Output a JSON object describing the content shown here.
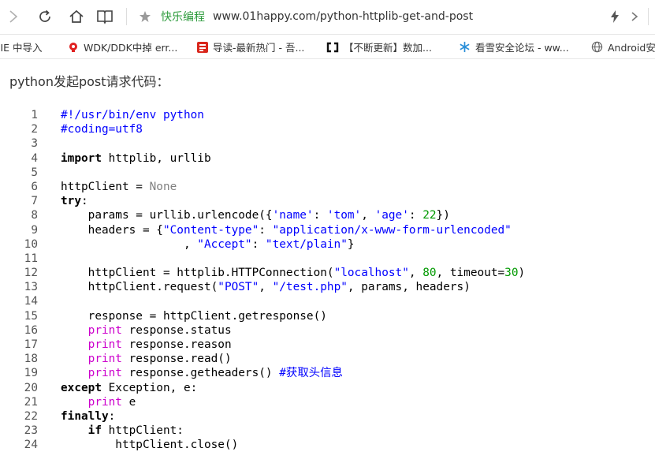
{
  "browser": {
    "site_name": "快乐编程",
    "url": "www.01happy.com/python-httplib-get-and-post",
    "bookmarks": [
      {
        "label": "入IE 中导入",
        "icon": "import-icon"
      },
      {
        "label": "WDK/DDK中掉 err...",
        "icon": "red-favicon"
      },
      {
        "label": "导读-最新热门 - 吾...",
        "icon": "red-square-favicon"
      },
      {
        "label": "【不断更新】数加...",
        "icon": "bracket-favicon"
      },
      {
        "label": "看雪安全论坛 - ww...",
        "icon": "snowflake-icon"
      },
      {
        "label": "Android安",
        "icon": "globe-icon"
      }
    ]
  },
  "article": {
    "intro": "python发起post请求代码："
  },
  "code": [
    {
      "n": "1",
      "t": [
        [
          "cm",
          "#!/usr/bin/env python"
        ]
      ]
    },
    {
      "n": "2",
      "t": [
        [
          "cm",
          "#coding=utf8"
        ]
      ]
    },
    {
      "n": "3",
      "t": []
    },
    {
      "n": "4",
      "t": [
        [
          "kw",
          "import"
        ],
        [
          "",
          " httplib, urllib"
        ]
      ]
    },
    {
      "n": "5",
      "t": []
    },
    {
      "n": "6",
      "t": [
        [
          "",
          "httpClient = "
        ],
        [
          "cs",
          "None"
        ]
      ]
    },
    {
      "n": "7",
      "t": [
        [
          "kw",
          "try"
        ],
        [
          "",
          ":"
        ]
      ]
    },
    {
      "n": "8",
      "t": [
        [
          "",
          "    params = urllib.urlencode({"
        ],
        [
          "st",
          "'name'"
        ],
        [
          "",
          ": "
        ],
        [
          "st",
          "'tom'"
        ],
        [
          "",
          ", "
        ],
        [
          "st",
          "'age'"
        ],
        [
          "",
          ": "
        ],
        [
          "nm",
          "22"
        ],
        [
          "",
          "})"
        ]
      ]
    },
    {
      "n": "9",
      "t": [
        [
          "",
          "    headers = {"
        ],
        [
          "st",
          "\"Content-type\""
        ],
        [
          "",
          ": "
        ],
        [
          "st",
          "\"application/x-www-form-urlencoded\""
        ]
      ]
    },
    {
      "n": "10",
      "t": [
        [
          "",
          "                  , "
        ],
        [
          "st",
          "\"Accept\""
        ],
        [
          "",
          ": "
        ],
        [
          "st",
          "\"text/plain\""
        ],
        [
          "",
          "}"
        ]
      ]
    },
    {
      "n": "11",
      "t": []
    },
    {
      "n": "12",
      "t": [
        [
          "",
          "    httpClient = httplib.HTTPConnection("
        ],
        [
          "st",
          "\"localhost\""
        ],
        [
          "",
          ", "
        ],
        [
          "nm",
          "80"
        ],
        [
          "",
          ", timeout="
        ],
        [
          "nm",
          "30"
        ],
        [
          "",
          ")"
        ]
      ]
    },
    {
      "n": "13",
      "t": [
        [
          "",
          "    httpClient.request("
        ],
        [
          "st",
          "\"POST\""
        ],
        [
          "",
          ", "
        ],
        [
          "st",
          "\"/test.php\""
        ],
        [
          "",
          ", params, headers)"
        ]
      ]
    },
    {
      "n": "14",
      "t": []
    },
    {
      "n": "15",
      "t": [
        [
          "",
          "    response = httpClient.getresponse()"
        ]
      ]
    },
    {
      "n": "16",
      "t": [
        [
          "",
          "    "
        ],
        [
          "kp",
          "print"
        ],
        [
          "",
          " response.status"
        ]
      ]
    },
    {
      "n": "17",
      "t": [
        [
          "",
          "    "
        ],
        [
          "kp",
          "print"
        ],
        [
          "",
          " response.reason"
        ]
      ]
    },
    {
      "n": "18",
      "t": [
        [
          "",
          "    "
        ],
        [
          "kp",
          "print"
        ],
        [
          "",
          " response.read()"
        ]
      ]
    },
    {
      "n": "19",
      "t": [
        [
          "",
          "    "
        ],
        [
          "kp",
          "print"
        ],
        [
          "",
          " response.getheaders() "
        ],
        [
          "cm",
          "#获取头信息"
        ]
      ]
    },
    {
      "n": "20",
      "t": [
        [
          "kw",
          "except"
        ],
        [
          "",
          " Exception, e:"
        ]
      ]
    },
    {
      "n": "21",
      "t": [
        [
          "",
          "    "
        ],
        [
          "kp",
          "print"
        ],
        [
          "",
          " e"
        ]
      ]
    },
    {
      "n": "22",
      "t": [
        [
          "kw",
          "finally"
        ],
        [
          "",
          ":"
        ]
      ]
    },
    {
      "n": "23",
      "t": [
        [
          "",
          "    "
        ],
        [
          "kw",
          "if"
        ],
        [
          "",
          " httpClient:"
        ]
      ]
    },
    {
      "n": "24",
      "t": [
        [
          "",
          "        httpClient.close()"
        ]
      ]
    }
  ],
  "colors": {
    "site_name": "#2f9c3e",
    "comment": "#0000ff",
    "string": "#0000ff",
    "number": "#009900",
    "print_keyword": "#cc00cc",
    "constant": "#808080"
  }
}
